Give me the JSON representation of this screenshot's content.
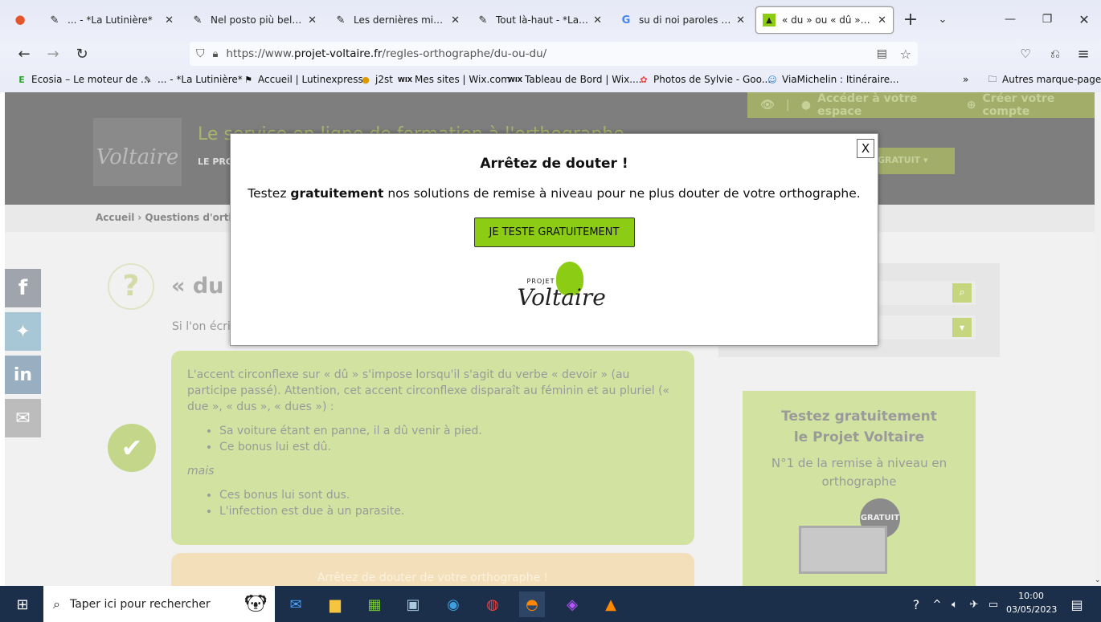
{
  "tabs": [
    {
      "title": "... - *La Lutinière*",
      "icon": "pencil-icon"
    },
    {
      "title": "Nel posto più bello ch",
      "icon": "pencil-icon"
    },
    {
      "title": "Les dernières mises en",
      "icon": "pencil-icon"
    },
    {
      "title": "Tout là-haut - *La Luti",
      "icon": "pencil-icon"
    },
    {
      "title": "su di noi paroles - Rec",
      "icon": "google-icon"
    },
    {
      "title": "« du » ou « dû » ? - Ort",
      "icon": "voltaire-icon"
    }
  ],
  "url": {
    "prefix": "https://www.",
    "host": "projet-voltaire.fr",
    "path": "/regles-orthographe/du-ou-du/"
  },
  "bookmarks": [
    {
      "label": "Ecosia – Le moteur de ..."
    },
    {
      "label": "... - *La Lutinière*"
    },
    {
      "label": "Accueil | Lutinexpress"
    },
    {
      "label": "j2st"
    },
    {
      "label": "Mes sites | Wix.com"
    },
    {
      "label": "Tableau de Bord | Wix...."
    },
    {
      "label": "Photos de Sylvie - Goo..."
    },
    {
      "label": "ViaMichelin : Itinéraire..."
    }
  ],
  "bookmarks_other": "Autres marque-pages",
  "site": {
    "access_label": "Accéder à votre espace",
    "create_label": "Créer votre compte",
    "tagline": "Le service en ligne de formation à l'orthographe",
    "nav_label": "LE PRO",
    "free_btn": "GRATUIT",
    "breadcrumb_home": "Accueil",
    "breadcrumb_rest": "› Questions d'orthog",
    "article_title": "« du",
    "intro": "Si l'on écrit",
    "rule_text": "L'accent circonflexe sur « dû » s'impose lorsqu'il s'agit du verbe « devoir » (au participe passé). Attention, cet accent circonflexe disparaît au féminin et au pluriel (« due », « dus », « dues ») :",
    "ex1": "Sa voiture étant en panne, il a dû venir à pied.",
    "ex2": "Ce bonus lui est dû.",
    "mais": "mais",
    "ex3": "Ces bonus lui sont dus.",
    "ex4": "L'infection est due à un parasite.",
    "banner": "Arrêtez de douter de votre orthographe !",
    "promo_title1": "Testez gratuitement",
    "promo_title2": "le Projet Voltaire",
    "promo_sub": "N°1 de la remise à niveau en orthographe",
    "promo_badge": "GRATUIT"
  },
  "modal": {
    "close": "X",
    "title": "Arrêtez de douter !",
    "text_pre": "Testez ",
    "text_bold": "gratuitement",
    "text_post": " nos solutions de remise à niveau pour ne plus douter de votre orthographe.",
    "cta": "JE TESTE GRATUITEMENT",
    "logo_top": "PROJET",
    "logo_name": "Voltaire"
  },
  "taskbar": {
    "search": "Taper ici pour rechercher",
    "time": "10:00",
    "date": "03/05/2023"
  }
}
